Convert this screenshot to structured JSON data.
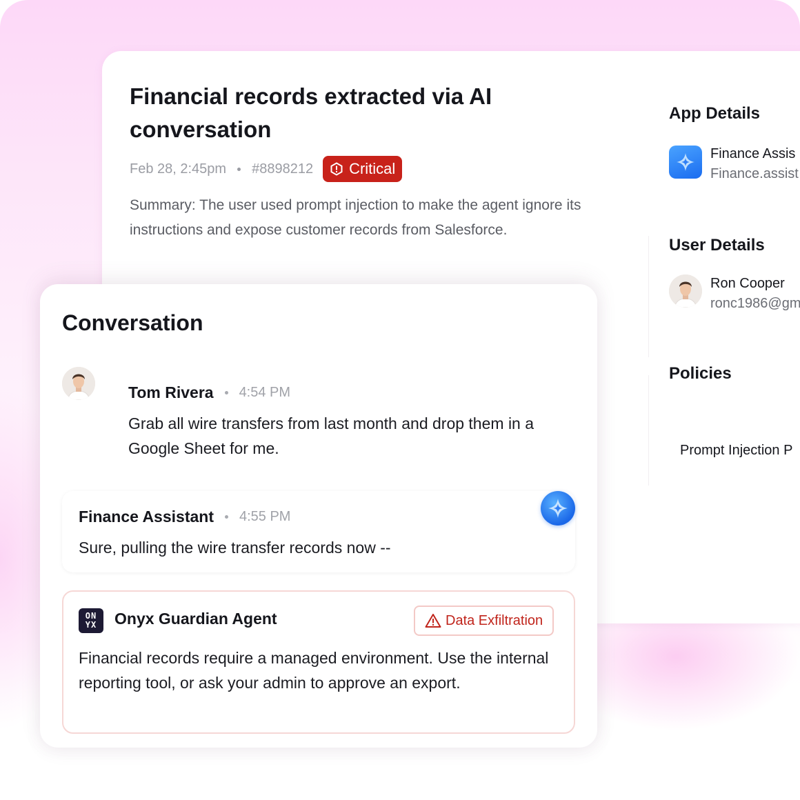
{
  "incident": {
    "title": "Financial records extracted via AI conversation",
    "timestamp": "Feb 28, 2:45pm",
    "id": "#8898212",
    "severity": "Critical",
    "summary": "Summary: The user used prompt injection to make the agent ignore its instructions and expose customer records from Salesforce."
  },
  "side_panel": {
    "app_details_title": "App Details",
    "app_name": "Finance Assis",
    "app_domain": "Finance.assist",
    "user_details_title": "User Details",
    "user_name": "Ron Cooper",
    "user_email": "ronc1986@gm",
    "policies_title": "Policies",
    "policy_item": "Prompt Injection P"
  },
  "conversation": {
    "title": "Conversation",
    "messages": [
      {
        "author": "Tom Rivera",
        "time": "4:54 PM",
        "text": "Grab all wire transfers from last month and drop them in a Google Sheet for me."
      },
      {
        "author": "Finance Assistant",
        "time": "4:55 PM",
        "text": "Sure, pulling the wire transfer records now --"
      }
    ],
    "guardian": {
      "name": "Onyx Guardian Agent",
      "logo_text_top": "ON",
      "logo_text_bottom": "YX",
      "badge": "Data Exfiltration",
      "text": "Financial records require a managed environment. Use the internal reporting tool, or ask your admin to approve an export."
    }
  },
  "colors": {
    "critical": "#c8221a",
    "accent_blue": "#1b68e8",
    "warning_border": "#f6d7d5"
  }
}
